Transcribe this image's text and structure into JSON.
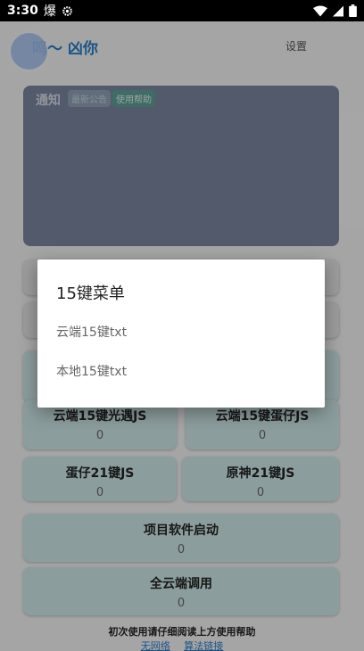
{
  "status_bar": {
    "time": "3:30",
    "notif_char": "爆"
  },
  "header": {
    "title": "鸣～ 凶你",
    "settings_label": "设置"
  },
  "notice": {
    "title": "通知",
    "chip_latest": "最新公告",
    "chip_help": "使用帮助"
  },
  "buttons": [
    {
      "label": "云端15键光遇JS",
      "count": "0"
    },
    {
      "label": "云端15键蛋仔JS",
      "count": "0"
    },
    {
      "label": "蛋仔21键JS",
      "count": "0"
    },
    {
      "label": "原神21键JS",
      "count": "0"
    },
    {
      "label": "项目软件启动",
      "count": "0"
    },
    {
      "label": "全云端调用",
      "count": "0"
    }
  ],
  "footer": {
    "note": "初次使用请仔细阅读上方使用帮助",
    "link_1": "无网络",
    "link_2": "算法链接"
  },
  "dialog": {
    "title": "15键菜单",
    "items": [
      "云端15键txt",
      "本地15键txt"
    ]
  }
}
